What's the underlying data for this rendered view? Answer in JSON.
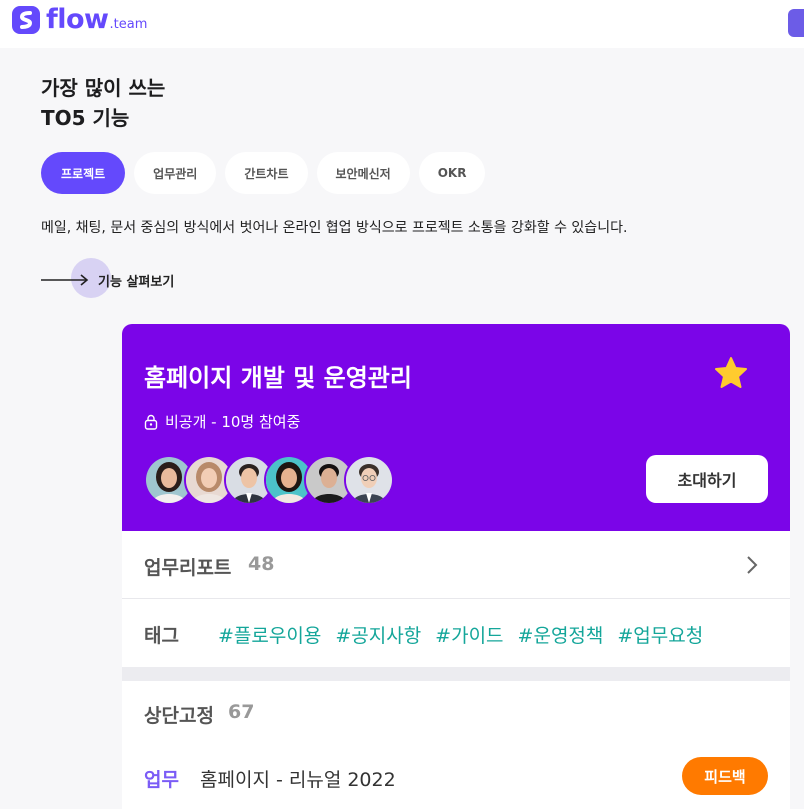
{
  "brand": {
    "name": "flow",
    "suffix": ".team",
    "color": "#6449fc"
  },
  "heading": {
    "line1": "가장 많이 쓰는",
    "line2": "TO5 기능"
  },
  "chips": [
    {
      "label": "프로젝트",
      "active": true
    },
    {
      "label": "업무관리",
      "active": false
    },
    {
      "label": "간트차트",
      "active": false
    },
    {
      "label": "보안메신저",
      "active": false
    },
    {
      "label": "OKR",
      "active": false
    }
  ],
  "description": "메일, 채팅, 문서 중심의 방식에서 벗어나 온라인 협업 방식으로 프로젝트 소통을 강화할 수 있습니다.",
  "explore_label": "기능 살펴보기",
  "project": {
    "title": "홈페이지 개발 및 운영관리",
    "visibility": "비공개 - 10명 참여중",
    "invite_label": "초대하기",
    "header_color": "#7b05e8",
    "starred": true
  },
  "report": {
    "label": "업무리포트",
    "count": "48"
  },
  "tags": {
    "label": "태그",
    "items": [
      "#플로우이용",
      "#공지사항",
      "#가이드",
      "#운영정책",
      "#업무요청"
    ]
  },
  "pinned": {
    "label": "상단고정",
    "count": "67"
  },
  "task": {
    "type": "업무",
    "title": "홈페이지 - 리뉴얼 2022",
    "status": "피드백",
    "status_color": "#ff7a00"
  }
}
